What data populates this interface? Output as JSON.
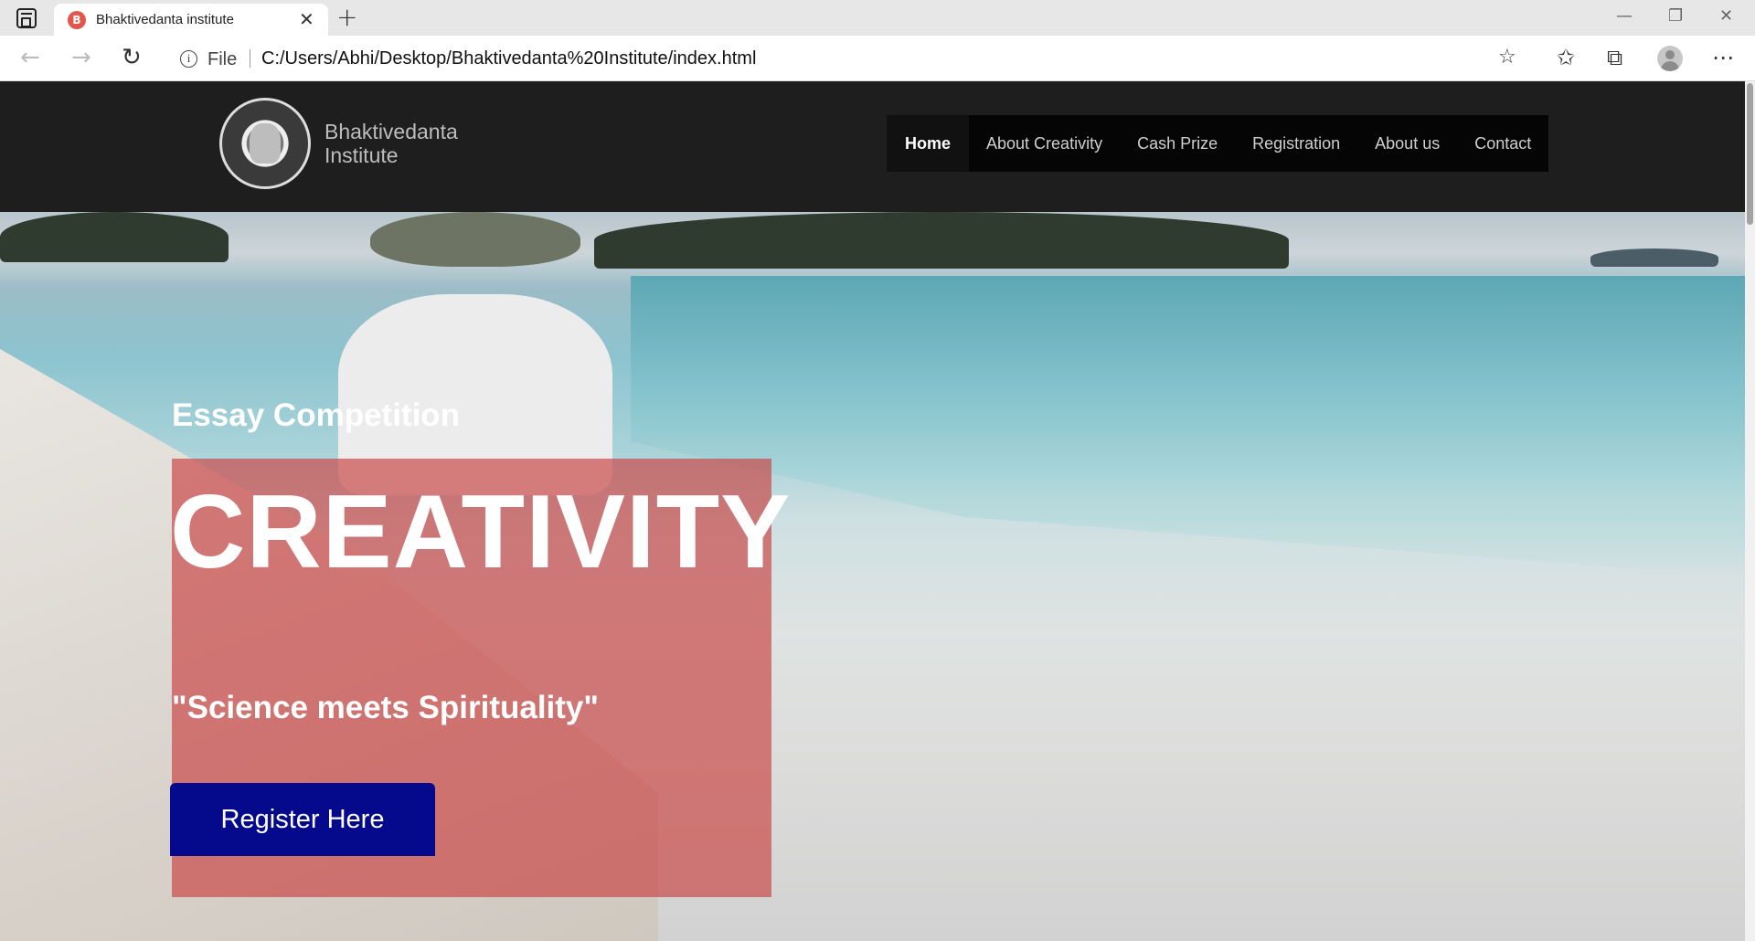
{
  "browser": {
    "tab_title": "Bhaktivedanta institute",
    "favicon_letter": "B",
    "file_label": "File",
    "url": "C:/Users/Abhi/Desktop/Bhaktivedanta%20Institute/index.html"
  },
  "site": {
    "brand_line1": "Bhaktivedanta",
    "brand_line2": "Institute",
    "nav": [
      "Home",
      "About Creativity",
      "Cash Prize",
      "Registration",
      "About us",
      "Contact"
    ],
    "nav_active": "Home"
  },
  "hero": {
    "subtitle": "Essay Competition",
    "title": "CREATIVITY",
    "tagline": "\"Science meets Spirituality\"",
    "cta_label": "Register Here"
  },
  "colors": {
    "header_bg": "#1e1e1e",
    "nav_bg": "#050505",
    "promo_overlay": "#c84646",
    "cta_bg": "#050a8c"
  }
}
